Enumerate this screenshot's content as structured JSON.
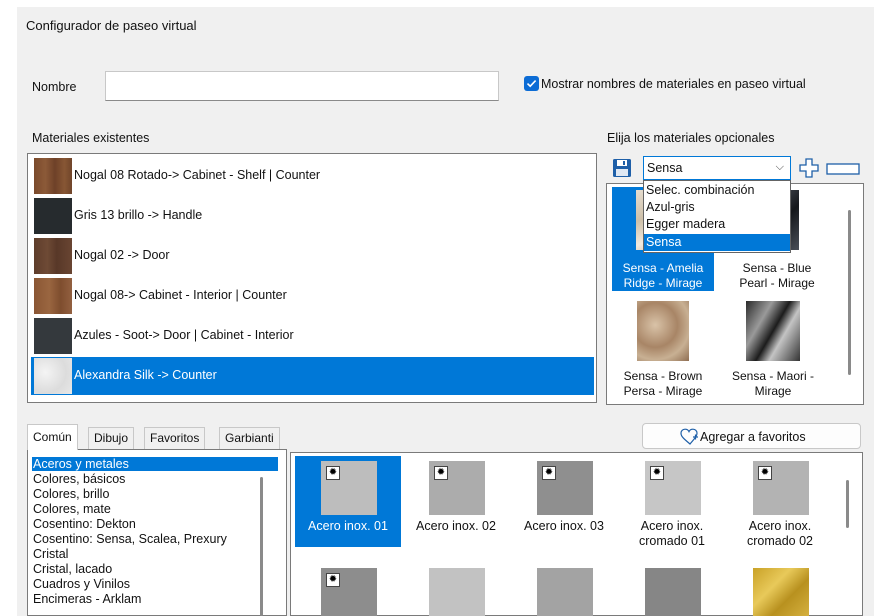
{
  "window": {
    "title": "Configurador de paseo virtual"
  },
  "form": {
    "name_label": "Nombre",
    "name_value": "",
    "show_names_label": "Mostrar nombres de materiales en paseo virtual",
    "show_names_checked": true
  },
  "existing": {
    "label": "Materiales existentes",
    "items": [
      {
        "label": "Nogal 08 Rotado-> Cabinet - Shelf  |  Counter",
        "swatch": "walnut"
      },
      {
        "label": "Gris 13 brillo -> Handle",
        "swatch": "dark-gray"
      },
      {
        "label": "Nogal 02 -> Door",
        "swatch": "walnut-dark"
      },
      {
        "label": "Nogal 08-> Cabinet - Interior  |  Counter",
        "swatch": "walnut"
      },
      {
        "label": "Azules - Soot-> Door  |  Cabinet - Interior",
        "swatch": "slate"
      },
      {
        "label": "Alexandra Silk -> Counter",
        "swatch": "marble-white"
      }
    ],
    "selected_index": 5
  },
  "optional": {
    "label": "Elija los materiales opcionales",
    "combo_value": "Sensa",
    "dropdown_options": [
      "Selec. combinación",
      "Azul-gris",
      "Egger madera",
      "Sensa"
    ],
    "dropdown_selected": 3,
    "items": [
      {
        "line1": "Sensa - Amelia",
        "line2": "Ridge - Mirage"
      },
      {
        "line1": "Sensa - Blue",
        "line2": "Pearl - Mirage"
      },
      {
        "line1": "Sensa - Brown",
        "line2": "Persa - Mirage"
      },
      {
        "line1": "Sensa - Maori -",
        "line2": "Mirage"
      }
    ],
    "icons": [
      "save-icon",
      "add-icon",
      "remove-icon"
    ]
  },
  "tabs": [
    "Común",
    "Dibujo",
    "Favoritos",
    "Garbianti"
  ],
  "active_tab": 0,
  "favorites_button": "Agregar a favoritos",
  "categories": [
    "Aceros y metales",
    "Colores, básicos",
    "Colores, brillo",
    "Colores, mate",
    "Cosentino: Dekton",
    "Cosentino: Sensa, Scalea, Prexury",
    "Cristal",
    "Cristal, lacado",
    "Cuadros y Vinilos",
    "Encimeras - Arklam"
  ],
  "selected_category": 0,
  "textures": [
    {
      "line1": "Acero inox. 01",
      "line2": ""
    },
    {
      "line1": "Acero inox. 02",
      "line2": ""
    },
    {
      "line1": "Acero inox. 03",
      "line2": ""
    },
    {
      "line1": "Acero inox.",
      "line2": "cromado 01"
    },
    {
      "line1": "Acero inox.",
      "line2": "cromado 02"
    }
  ],
  "selected_texture": 0,
  "colors": {
    "accent": "#0078d7",
    "checkbox": "#0c6cd5",
    "panel_bg": "#f0f0f0"
  }
}
